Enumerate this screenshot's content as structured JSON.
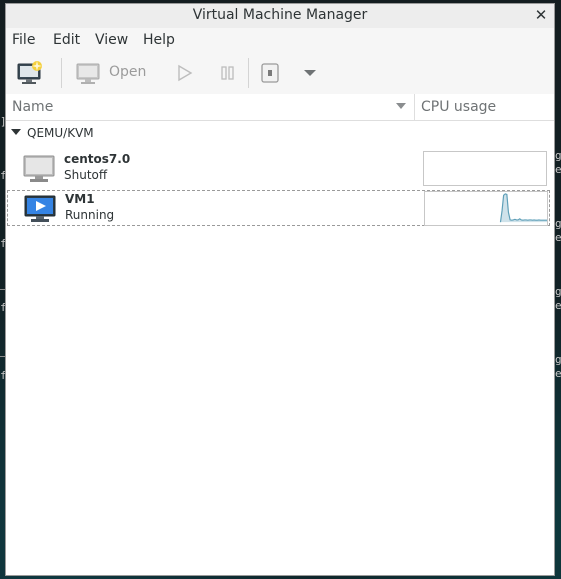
{
  "window": {
    "title": "Virtual Machine Manager",
    "close_glyph": "✕"
  },
  "menubar": {
    "items": [
      "File",
      "Edit",
      "View",
      "Help"
    ]
  },
  "toolbar": {
    "new_vm_icon": "new-vm-icon",
    "open_label": "Open",
    "run_icon": "play-icon",
    "pause_icon": "pause-icon",
    "shutdown_icon": "shutdown-icon",
    "dropdown_icon": "chevron-down-icon"
  },
  "list": {
    "columns": {
      "name": "Name",
      "cpu": "CPU usage"
    },
    "group": {
      "label": "QEMU/KVM",
      "vms": [
        {
          "name": "centos7.0",
          "state": "Shutoff",
          "icon": "monitor-icon",
          "cpu_usage": [
            0,
            0,
            0,
            0,
            0,
            0,
            0,
            0,
            0,
            0,
            0,
            0,
            0,
            0,
            0,
            0,
            0,
            0,
            0,
            0
          ]
        },
        {
          "name": "VM1",
          "state": "Running",
          "icon": "running-monitor-icon",
          "cpu_usage": [
            0,
            0,
            0,
            0,
            0,
            0,
            0,
            0,
            0,
            0,
            0,
            0,
            0,
            0,
            0,
            0,
            0,
            0,
            0,
            0,
            0,
            0,
            0,
            0,
            0,
            0,
            0,
            0,
            0,
            0,
            0,
            0,
            0,
            0,
            0,
            0,
            0,
            0,
            0,
            0,
            0,
            0,
            0,
            0,
            0,
            0,
            0,
            0,
            0.4,
            0.95,
            1.0,
            0.98,
            0.35,
            0.08,
            0.07,
            0.08,
            0.1,
            0.08,
            0.08,
            0.12,
            0.08,
            0.07,
            0.08,
            0.08,
            0.07,
            0.08,
            0.08,
            0.07,
            0.08,
            0.07,
            0.07,
            0.08,
            0.07,
            0.07,
            0.07,
            0.07,
            0.07
          ]
        }
      ]
    }
  },
  "colors": {
    "accent": "#3584e4",
    "graph_line": "#5e9fb8",
    "graph_fill": "#cfe2ea"
  }
}
